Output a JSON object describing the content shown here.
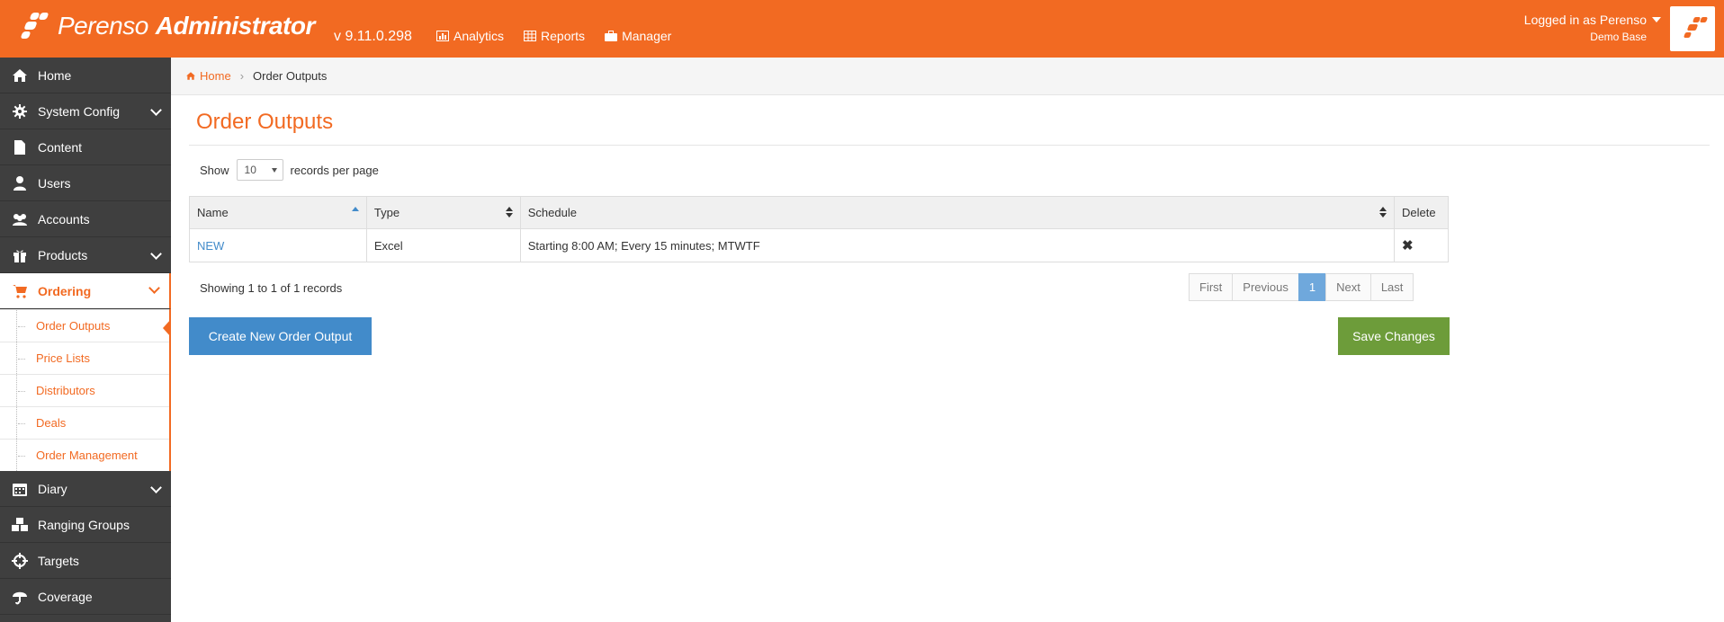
{
  "header": {
    "brand_name": "Perenso",
    "brand_suffix": "Administrator",
    "version": "v 9.11.0.298",
    "nav": [
      {
        "label": "Analytics",
        "icon": "chart-icon"
      },
      {
        "label": "Reports",
        "icon": "table-icon"
      },
      {
        "label": "Manager",
        "icon": "briefcase-icon"
      }
    ],
    "user_label": "Logged in as Perenso",
    "base_label": "Demo Base"
  },
  "sidebar": {
    "items": [
      {
        "label": "Home",
        "icon": "home-icon"
      },
      {
        "label": "System Config",
        "icon": "gear-icon"
      },
      {
        "label": "Content",
        "icon": "file-icon"
      },
      {
        "label": "Users",
        "icon": "user-icon"
      },
      {
        "label": "Accounts",
        "icon": "users-icon"
      },
      {
        "label": "Products",
        "icon": "gift-icon"
      },
      {
        "label": "Ordering",
        "icon": "cart-icon"
      },
      {
        "label": "Diary",
        "icon": "calendar-icon"
      },
      {
        "label": "Ranging Groups",
        "icon": "cubes-icon"
      },
      {
        "label": "Targets",
        "icon": "crosshairs-icon"
      },
      {
        "label": "Coverage",
        "icon": "umbrella-icon"
      }
    ],
    "sub_items": [
      {
        "label": "Order Outputs"
      },
      {
        "label": "Price Lists"
      },
      {
        "label": "Distributors"
      },
      {
        "label": "Deals"
      },
      {
        "label": "Order Management"
      }
    ]
  },
  "breadcrumb": {
    "home": "Home",
    "current": "Order Outputs"
  },
  "page": {
    "title": "Order Outputs",
    "show_label": "Show",
    "page_size": "10",
    "records_label": "records per page",
    "info": "Showing 1 to 1 of 1 records"
  },
  "table": {
    "headers": [
      "Name",
      "Type",
      "Schedule",
      "Delete"
    ],
    "rows": [
      {
        "name": "NEW",
        "type": "Excel",
        "schedule": "Starting 8:00 AM; Every 15 minutes; MTWTF",
        "delete": "✖"
      }
    ]
  },
  "pager": {
    "first": "First",
    "previous": "Previous",
    "current": "1",
    "next": "Next",
    "last": "Last"
  },
  "buttons": {
    "create": "Create New Order Output",
    "save": "Save Changes"
  },
  "colors": {
    "brand": "#f26a22",
    "primary": "#428bca",
    "success": "#6d9c3a",
    "sidebar": "#3f3f3f"
  }
}
